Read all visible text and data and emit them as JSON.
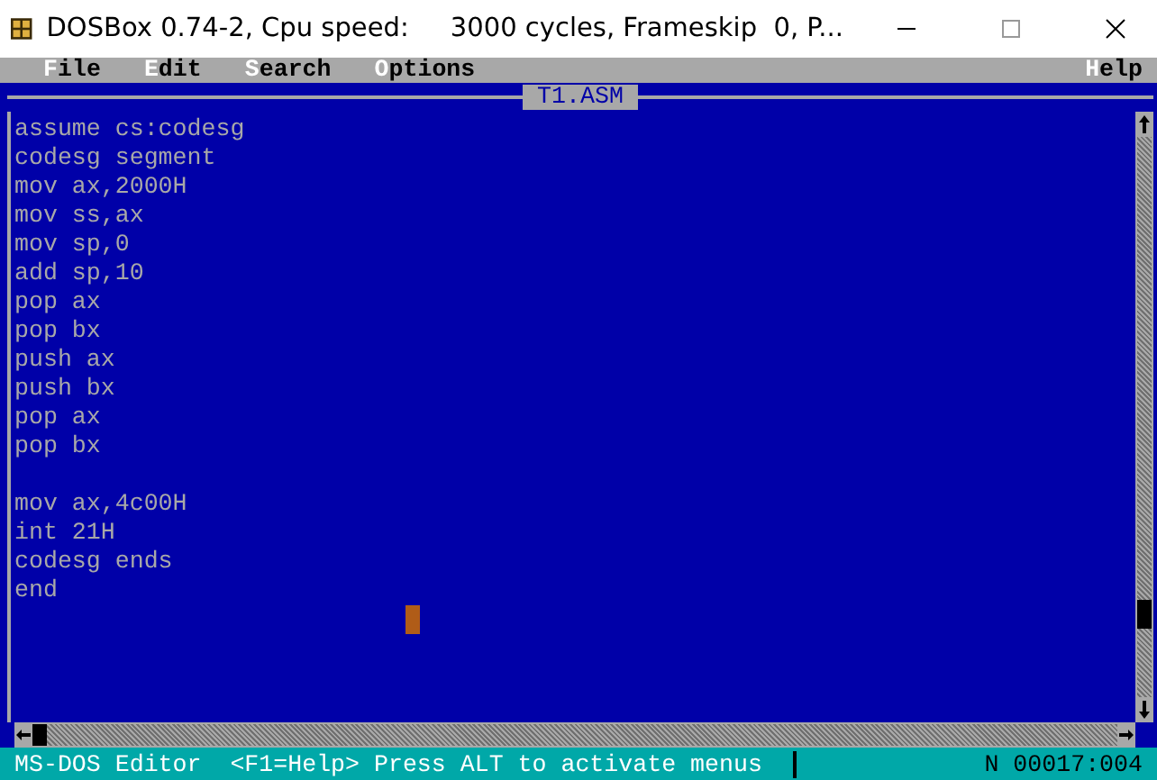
{
  "window": {
    "title": "DOSBox 0.74-2, Cpu speed:     3000 cycles, Frameskip  0, P..."
  },
  "menu": {
    "left": [
      "File",
      "Edit",
      "Search",
      "Options"
    ],
    "right": [
      "Help"
    ]
  },
  "editor": {
    "title": "T1.ASM",
    "blocks": [
      [
        "assume cs:codesg",
        "codesg segment",
        "mov ax,2000H",
        "mov ss,ax",
        "mov sp,0",
        "add sp,10",
        "pop ax",
        "pop bx",
        "push ax",
        "push bx",
        "pop ax",
        "pop bx"
      ],
      [
        "mov ax,4c00H",
        "int 21H",
        "codesg ends",
        "end"
      ]
    ]
  },
  "status_bar": {
    "message": "MS-DOS Editor  <F1=Help> Press ALT to activate menus",
    "indicator": "N",
    "position": "00017:004"
  }
}
